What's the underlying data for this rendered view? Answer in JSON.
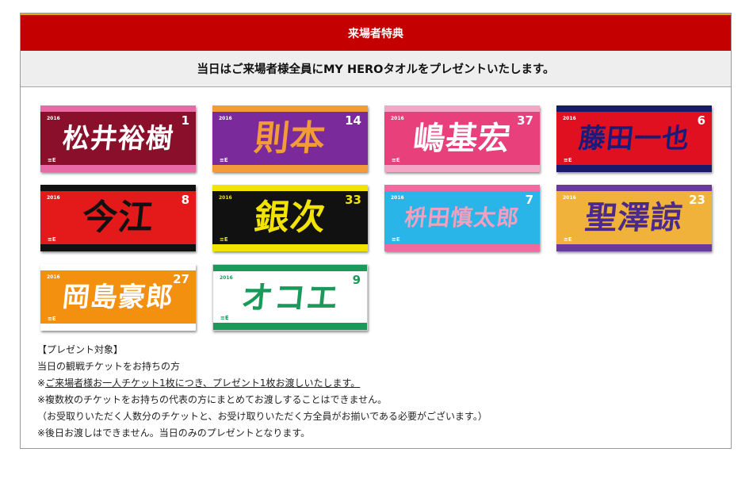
{
  "header": {
    "title": "来場者特典"
  },
  "subheader": {
    "text": "当日はご来場者様全員にMY HEROタオルをプレゼントいたします。"
  },
  "towels": [
    {
      "name": "松井裕樹",
      "number": "1",
      "year": "2016",
      "bg": "#8a0f2a",
      "text": "#ffffff",
      "stripe": "#e86aa6",
      "numcolor": "#ffffff"
    },
    {
      "name": "則本",
      "number": "14",
      "year": "2016",
      "bg": "#7a2a9a",
      "text": "#f39a3a",
      "stripe": "#f39a3a",
      "numcolor": "#ffffff"
    },
    {
      "name": "嶋基宏",
      "number": "37",
      "year": "2016",
      "bg": "#e8407a",
      "text": "#ffffff",
      "stripe": "#f4a6c6",
      "numcolor": "#ffffff"
    },
    {
      "name": "藤田一也",
      "number": "6",
      "year": "2016",
      "bg": "#e01020",
      "text": "#1a1a7a",
      "stripe": "#1a1a6a",
      "numcolor": "#ffffff"
    },
    {
      "name": "今江",
      "number": "8",
      "year": "2016",
      "bg": "#e41a1a",
      "text": "#111111",
      "stripe": "#111111",
      "numcolor": "#ffffff"
    },
    {
      "name": "銀次",
      "number": "33",
      "year": "2016",
      "bg": "#111111",
      "text": "#f2e400",
      "stripe": "#f2e400",
      "numcolor": "#f2e400"
    },
    {
      "name": "枡田慎太郎",
      "number": "7",
      "year": "2016",
      "bg": "#29b5e8",
      "text": "#f2a0c0",
      "stripe": "#f06aa0",
      "numcolor": "#ffffff"
    },
    {
      "name": "聖澤諒",
      "number": "23",
      "year": "2016",
      "bg": "#f0b23a",
      "text": "#4a2a8a",
      "stripe": "#6a3a9a",
      "numcolor": "#ffffff"
    },
    {
      "name": "岡島豪郎",
      "number": "27",
      "year": "2016",
      "bg": "#f39010",
      "text": "#ffffff",
      "stripe": "#ffffff",
      "numcolor": "#ffffff"
    },
    {
      "name": "オコエ",
      "number": "9",
      "year": "2016",
      "bg": "#ffffff",
      "text": "#1a9a5a",
      "stripe": "#1a9a5a",
      "numcolor": "#1a9a5a"
    }
  ],
  "notes": {
    "line1": "【プレゼント対象】",
    "line2": "当日の観戦チケットをお持ちの方",
    "line3_prefix": "※",
    "line3_underlined": "ご来場者様お一人チケット1枚につき、プレゼント1枚お渡しいたします。",
    "line4": "※複数枚のチケットをお持ちの代表の方にまとめてお渡しすることはできません。",
    "line5": "（お受取りいただく人数分のチケットと、お受け取りいただく方全員がお揃いである必要がございます。）",
    "line6": "※後日お渡しはできません。当日のみのプレゼントとなります。"
  }
}
